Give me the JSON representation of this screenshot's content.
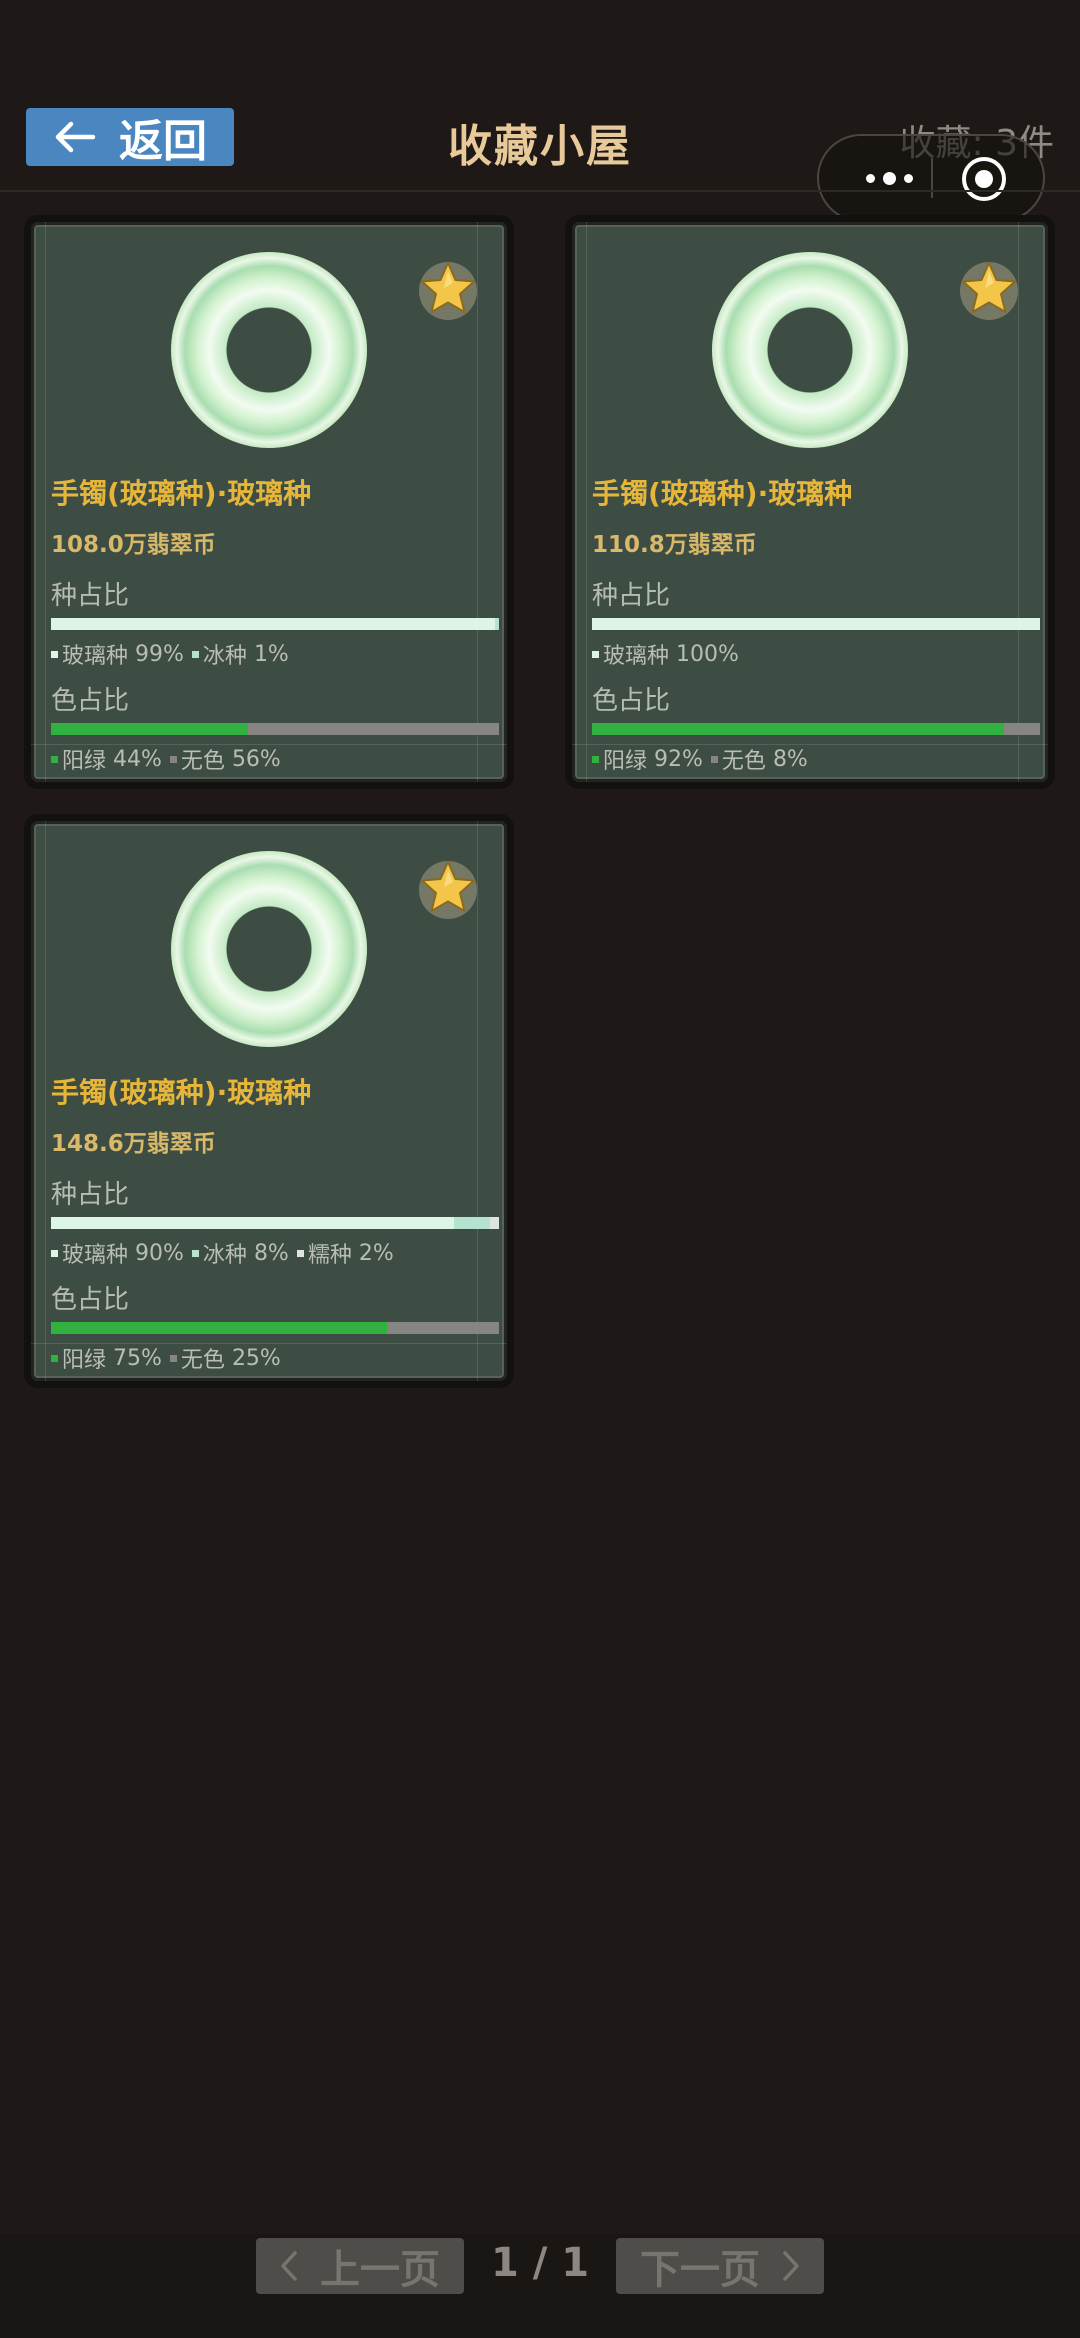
{
  "header": {
    "back_label": "返回",
    "title": "收藏小屋",
    "count_text": "收藏: 3件"
  },
  "colors": {
    "back_button": "#4a86c0",
    "title": "#e8c99a",
    "item_name": "#e5b63a",
    "price": "#d8b96a",
    "card_bg": "#3e4d44",
    "glass_type": "#ddf5e6",
    "ice_type": "#b5e3cf",
    "waxy_type": "#dfe4df",
    "green": "#31b13f",
    "colorless": "#868582"
  },
  "cards": [
    {
      "name": "手镯(玻璃种)·玻璃种",
      "price": "108.0万翡翠币",
      "type_label": "种占比",
      "types": [
        {
          "label": "玻璃种",
          "pct_text": "99%",
          "value": 99,
          "color": "#ddf5e6"
        },
        {
          "label": "冰种",
          "pct_text": "1%",
          "value": 1,
          "color": "#b5e3cf"
        }
      ],
      "color_label": "色占比",
      "color_parts": [
        {
          "label": "阳绿",
          "pct_text": "44%",
          "value": 44,
          "color": "#31b13f"
        },
        {
          "label": "无色",
          "pct_text": "56%",
          "value": 56,
          "color": "#868582"
        }
      ]
    },
    {
      "name": "手镯(玻璃种)·玻璃种",
      "price": "110.8万翡翠币",
      "type_label": "种占比",
      "types": [
        {
          "label": "玻璃种",
          "pct_text": "100%",
          "value": 100,
          "color": "#ddf5e6"
        }
      ],
      "color_label": "色占比",
      "color_parts": [
        {
          "label": "阳绿",
          "pct_text": "92%",
          "value": 92,
          "color": "#31b13f"
        },
        {
          "label": "无色",
          "pct_text": "8%",
          "value": 8,
          "color": "#868582"
        }
      ]
    },
    {
      "name": "手镯(玻璃种)·玻璃种",
      "price": "148.6万翡翠币",
      "type_label": "种占比",
      "types": [
        {
          "label": "玻璃种",
          "pct_text": "90%",
          "value": 90,
          "color": "#ddf5e6"
        },
        {
          "label": "冰种",
          "pct_text": "8%",
          "value": 8,
          "color": "#b5e3cf"
        },
        {
          "label": "糯种",
          "pct_text": "2%",
          "value": 2,
          "color": "#dfe4df"
        }
      ],
      "color_label": "色占比",
      "color_parts": [
        {
          "label": "阳绿",
          "pct_text": "75%",
          "value": 75,
          "color": "#31b13f"
        },
        {
          "label": "无色",
          "pct_text": "25%",
          "value": 25,
          "color": "#868582"
        }
      ]
    }
  ],
  "pagination": {
    "prev_label": "上一页",
    "next_label": "下一页",
    "indicator": "1 / 1"
  }
}
